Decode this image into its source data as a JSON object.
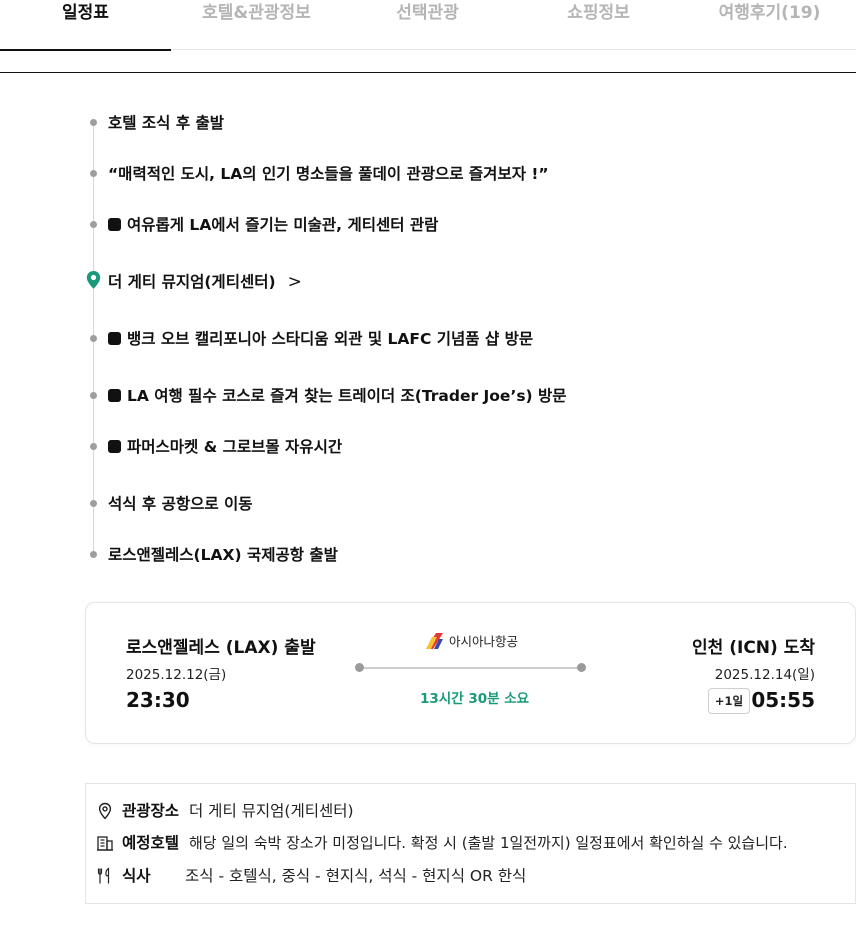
{
  "tabs": [
    {
      "label": "일정표",
      "active": true
    },
    {
      "label": "호텔&관광정보",
      "active": false
    },
    {
      "label": "선택관광",
      "active": false
    },
    {
      "label": "쇼핑정보",
      "active": false
    },
    {
      "label": "여행후기(19)",
      "active": false
    }
  ],
  "timeline": {
    "items": [
      {
        "text": "호텔 조식 후 출발",
        "type": "dot"
      },
      {
        "text": "“매력적인 도시, LA의 인기 명소들을 풀데이 관광으로 즐겨보자 !”",
        "type": "dot"
      },
      {
        "text": "여유롭게 LA에서 즐기는 미술관, 게티센터 관람",
        "type": "dot-square"
      },
      {
        "text": "더 게티 뮤지엄(게티센터)",
        "type": "pin-link"
      },
      {
        "text": "뱅크 오브 캘리포니아 스타디움 외관 및 LAFC 기념품 샵 방문",
        "type": "dot-square"
      },
      {
        "text": "LA 여행 필수 코스로 즐겨 찾는 트레이더 조(Trader Joe’s) 방문",
        "type": "dot-square"
      },
      {
        "text": "파머스마켓 & 그로브몰 자유시간",
        "type": "dot-square"
      },
      {
        "text": "석식 후 공항으로 이동",
        "type": "dot"
      },
      {
        "text": "로스앤젤레스(LAX) 국제공항 출발",
        "type": "dot"
      }
    ]
  },
  "flight": {
    "departure": {
      "title": "로스앤젤레스 (LAX) 출발",
      "date": "2025.12.12(금)",
      "time": "23:30"
    },
    "arrival": {
      "title": "인천 (ICN) 도착",
      "date": "2025.12.14(일)",
      "time": "05:55",
      "day_offset": "+1일"
    },
    "airline": "아시아나항공",
    "duration": "13시간 30분 소요",
    "accent_color": "#1a9a7a"
  },
  "info": {
    "sightseeing": {
      "label": "관광장소",
      "value": "더 게티 뮤지엄(게티센터)",
      "icon": "location-pin-icon"
    },
    "hotel": {
      "label": "예정호텔",
      "value": "해당 일의 숙박 장소가 미정입니다. 확정 시 (출발 1일전까지) 일정표에서 확인하실 수 있습니다.",
      "icon": "hotel-building-icon"
    },
    "meal": {
      "label": "식사",
      "value": "조식 - 호텔식, 중식 - 현지식, 석식 - 현지식 OR 한식",
      "icon": "fork-knife-icon"
    }
  }
}
